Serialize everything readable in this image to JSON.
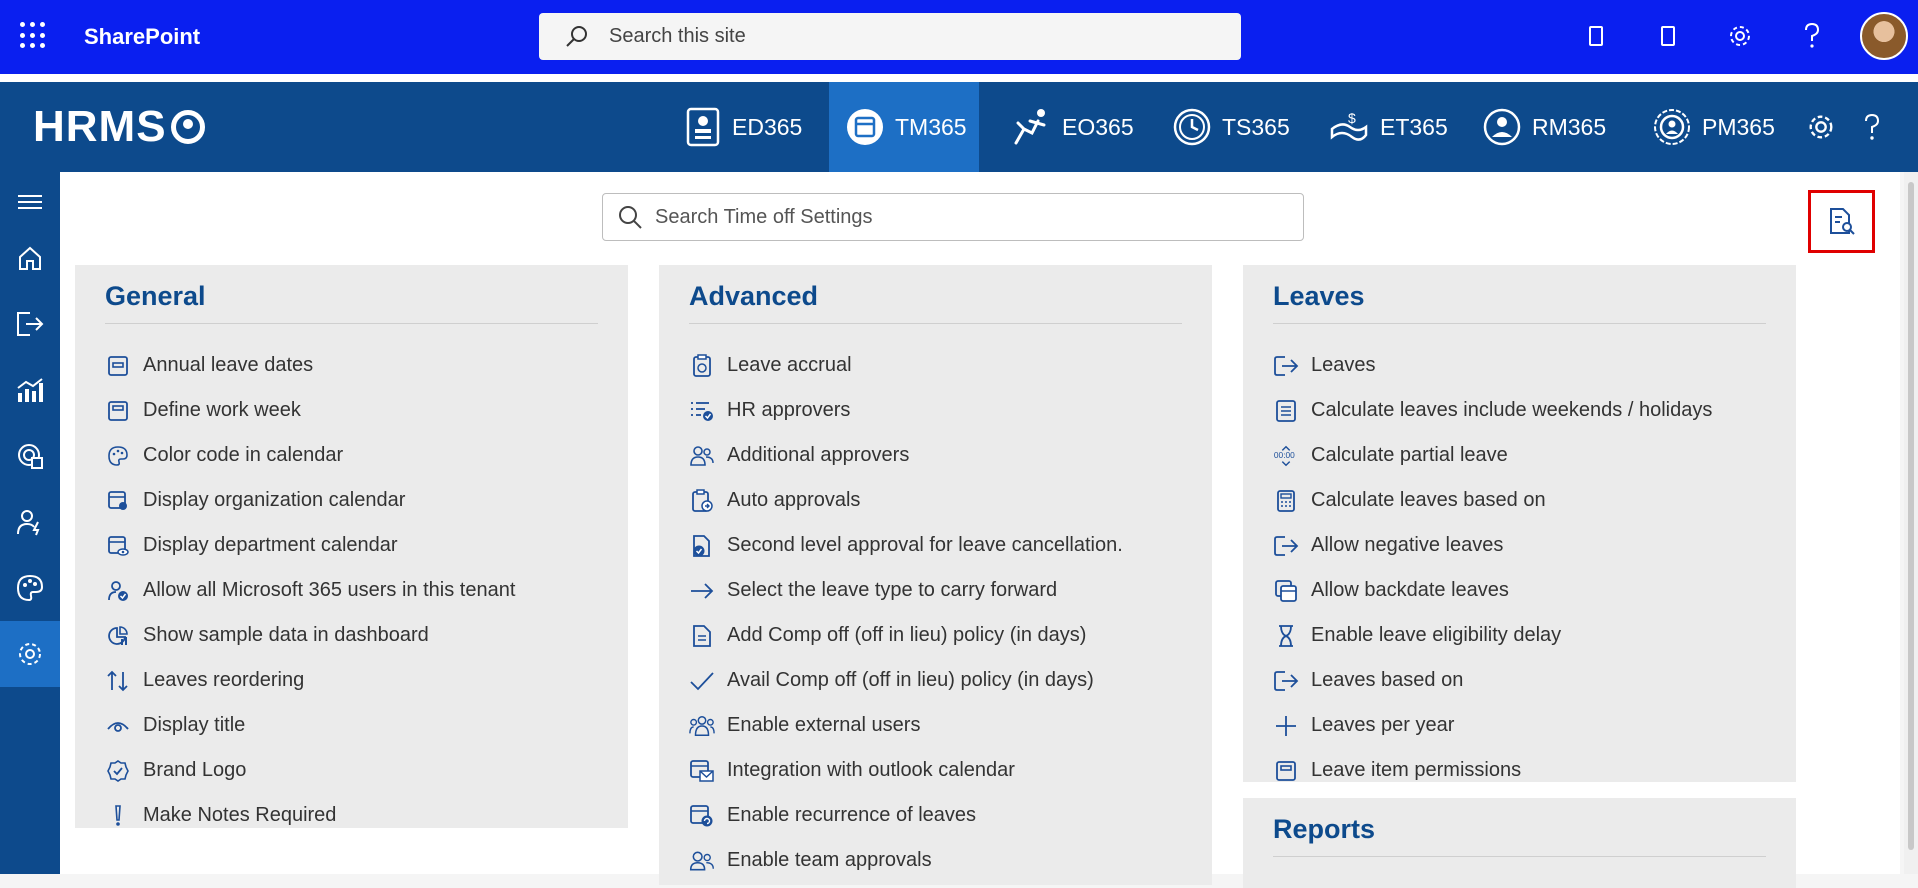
{
  "sharepoint": {
    "title": "SharePoint",
    "search_placeholder": "Search this site"
  },
  "hrms": {
    "logo": "HRMS",
    "nav": [
      {
        "label": "ED365",
        "icon": "ed365-icon"
      },
      {
        "label": "TM365",
        "icon": "tm365-icon",
        "active": true
      },
      {
        "label": "EO365",
        "icon": "eo365-icon"
      },
      {
        "label": "TS365",
        "icon": "ts365-icon"
      },
      {
        "label": "ET365",
        "icon": "et365-icon"
      },
      {
        "label": "RM365",
        "icon": "rm365-icon"
      },
      {
        "label": "PM365",
        "icon": "pm365-icon"
      }
    ]
  },
  "content": {
    "search_placeholder": "Search Time off Settings"
  },
  "cards": {
    "general": {
      "title": "General",
      "items": [
        "Annual leave dates",
        "Define work week",
        "Color code in calendar",
        "Display organization calendar",
        "Display department calendar",
        "Allow all Microsoft 365 users in this tenant",
        "Show sample data in dashboard",
        "Leaves reordering",
        "Display title",
        "Brand Logo",
        "Make Notes Required"
      ]
    },
    "advanced": {
      "title": "Advanced",
      "items": [
        "Leave accrual",
        "HR approvers",
        "Additional approvers",
        "Auto approvals",
        "Second level approval for leave cancellation.",
        "Select the leave type to carry forward",
        "Add Comp off (off in lieu) policy (in days)",
        "Avail Comp off (off in lieu) policy (in days)",
        "Enable external users",
        "Integration with outlook calendar",
        "Enable recurrence of leaves",
        "Enable team approvals"
      ]
    },
    "leaves": {
      "title": "Leaves",
      "items": [
        "Leaves",
        "Calculate leaves include weekends / holidays",
        "Calculate partial leave",
        "Calculate leaves based on",
        "Allow negative leaves",
        "Allow backdate leaves",
        "Enable leave eligibility delay",
        "Leaves based on",
        "Leaves per year",
        "Leave item permissions"
      ]
    },
    "reports": {
      "title": "Reports"
    }
  },
  "colors": {
    "sharepoint_bar": "#0a1ff0",
    "hrms_bar": "#0d4a8c",
    "active": "#1d6fc5",
    "highlight_border": "#e00000"
  }
}
